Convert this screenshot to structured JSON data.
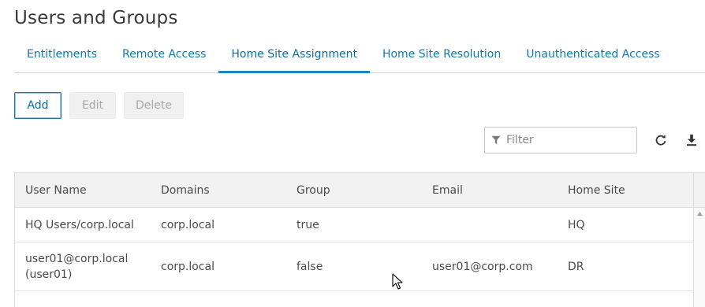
{
  "page": {
    "title": "Users and Groups"
  },
  "tabs": [
    {
      "label": "Entitlements",
      "active": false
    },
    {
      "label": "Remote Access",
      "active": false
    },
    {
      "label": "Home Site Assignment",
      "active": true
    },
    {
      "label": "Home Site Resolution",
      "active": false
    },
    {
      "label": "Unauthenticated Access",
      "active": false
    }
  ],
  "toolbar": {
    "add_label": "Add",
    "edit_label": "Edit",
    "delete_label": "Delete"
  },
  "filter": {
    "placeholder": "Filter",
    "value": ""
  },
  "icons": {
    "filter": "filter-icon",
    "refresh": "refresh-icon",
    "download": "download-icon"
  },
  "table": {
    "columns": [
      "User Name",
      "Domains",
      "Group",
      "Email",
      "Home Site"
    ],
    "rows": [
      {
        "user_name": "HQ Users/corp.local",
        "user_name_line2": "",
        "domains": "corp.local",
        "group": "true",
        "email": "",
        "home_site": "HQ"
      },
      {
        "user_name": "user01@corp.local",
        "user_name_line2": "(user01)",
        "domains": "corp.local",
        "group": "false",
        "email": "user01@corp.com",
        "home_site": "DR"
      }
    ]
  },
  "colors": {
    "accent": "#0b7bb0",
    "tab_underline": "#1a86bd",
    "header_bg": "#f2f2f2",
    "disabled_bg": "#f0f0f0"
  }
}
